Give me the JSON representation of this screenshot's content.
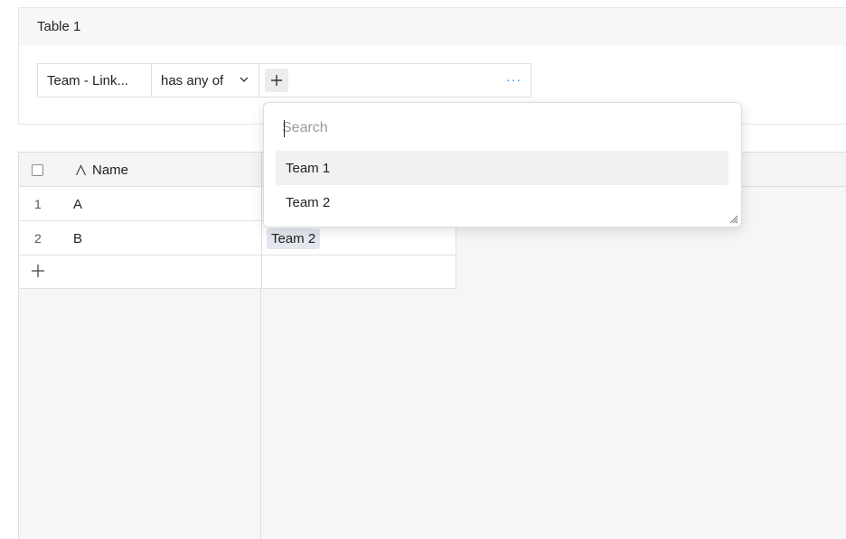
{
  "table": {
    "title": "Table 1"
  },
  "filter": {
    "field": "Team - Link...",
    "operator": "has any of",
    "add_symbol": "+",
    "more": "···"
  },
  "grid": {
    "header": {
      "name_col": "Name"
    },
    "rows": [
      {
        "num": "1",
        "name": "A",
        "team": ""
      },
      {
        "num": "2",
        "name": "B",
        "team": "Team 2"
      }
    ],
    "add_row_symbol": "+"
  },
  "dropdown": {
    "search_placeholder": "Search",
    "options": [
      "Team 1",
      "Team 2"
    ],
    "highlighted_index": 0
  },
  "icons": {
    "chevron": "chevron-down-icon",
    "plus": "plus-icon",
    "text_field": "text-field-icon",
    "resize": "resize-handle-icon"
  },
  "colors": {
    "accent": "#1c7ed6",
    "chip_bg": "#e3e8ee",
    "highlight_bg": "#f0f0f0"
  }
}
